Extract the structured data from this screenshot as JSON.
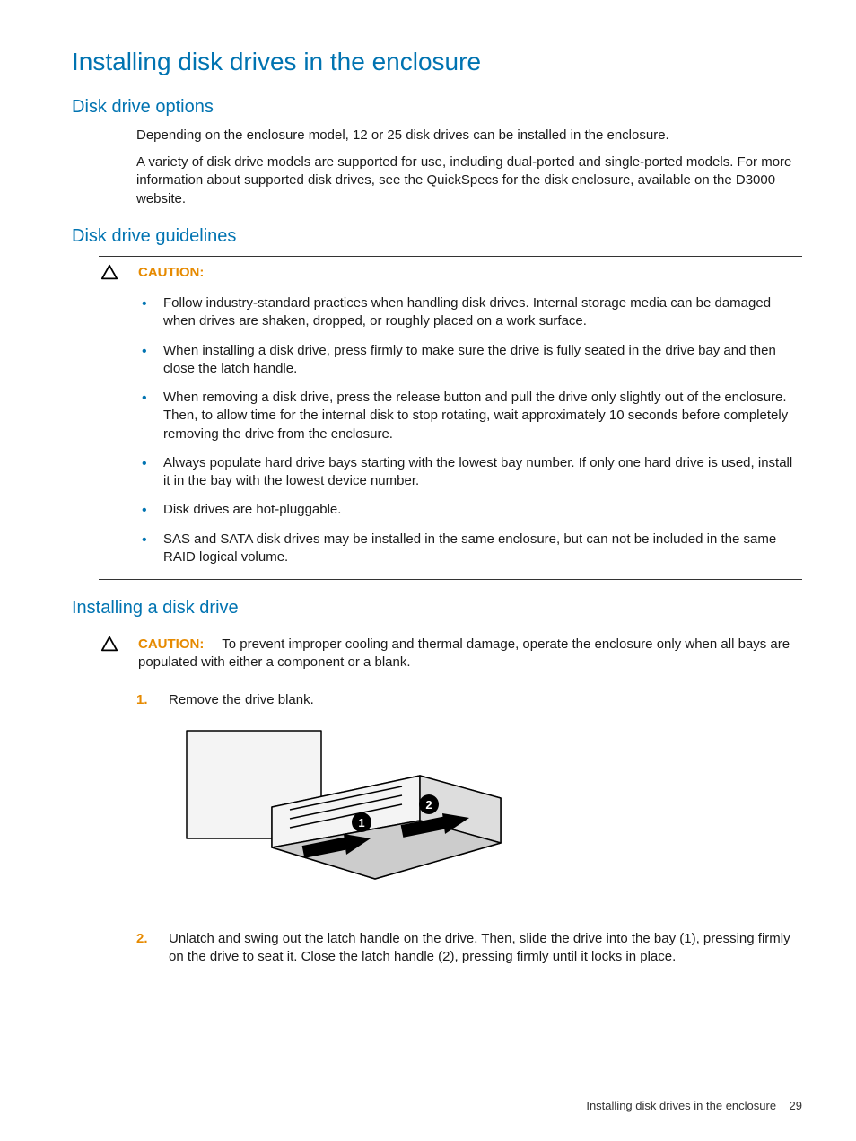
{
  "title": "Installing disk drives in the enclosure",
  "sections": {
    "options": {
      "heading": "Disk drive options",
      "p1": "Depending on the enclosure model, 12 or 25 disk drives can be installed in the enclosure.",
      "p2": "A variety of disk drive models are supported for use, including dual-ported and single-ported models. For more information about supported disk drives, see the QuickSpecs for the disk enclosure, available on the D3000 website."
    },
    "guidelines": {
      "heading": "Disk drive guidelines",
      "caution_label": "CAUTION:",
      "items": [
        "Follow industry-standard practices when handling disk drives. Internal storage media can be damaged when drives are shaken, dropped, or roughly placed on a work surface.",
        "When installing a disk drive, press firmly to make sure the drive is fully seated in the drive bay and then close the latch handle.",
        "When removing a disk drive, press the release button and pull the drive only slightly out of the enclosure. Then, to allow time for the internal disk to stop rotating, wait approximately 10 seconds before completely removing the drive from the enclosure.",
        "Always populate hard drive bays starting with the lowest bay number. If only one hard drive is used, install it in the bay with the lowest device number.",
        "Disk drives are hot-pluggable.",
        "SAS and SATA disk drives may be installed in the same enclosure, but can not be included in the same RAID logical volume."
      ]
    },
    "installing": {
      "heading": "Installing a disk drive",
      "caution_label": "CAUTION:",
      "caution_text": "To prevent improper cooling and thermal damage, operate the enclosure only when all bays are populated with either a component or a blank.",
      "steps": [
        "Remove the drive blank.",
        "Unlatch and swing out the latch handle on the drive. Then, slide the drive into the bay (1), pressing firmly on the drive to seat it. Close the latch handle (2), pressing firmly until it locks in place."
      ]
    }
  },
  "footer": {
    "text": "Installing disk drives in the enclosure",
    "page": "29"
  }
}
